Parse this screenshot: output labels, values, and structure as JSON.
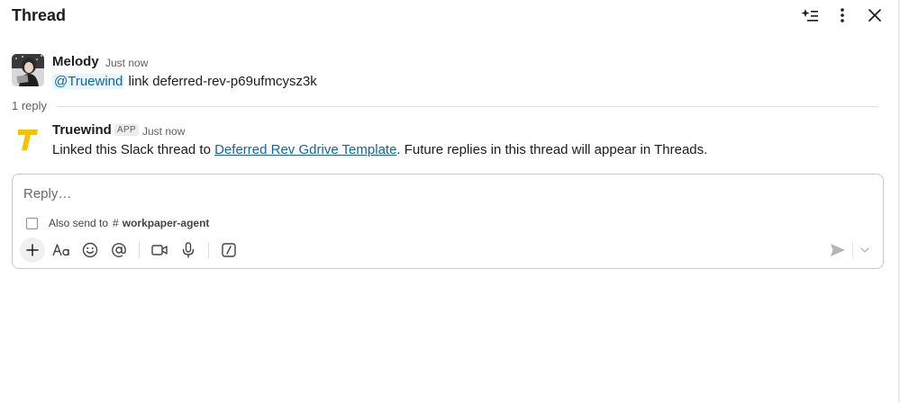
{
  "header": {
    "title": "Thread"
  },
  "messages": [
    {
      "author": "Melody",
      "time": "Just now",
      "mention": "@Truewind",
      "text": " link deferred-rev-p69ufmcysz3k"
    },
    {
      "author": "Truewind",
      "badge": "APP",
      "time": "Just now",
      "text_before": "Linked this Slack thread to ",
      "link_text": "Deferred Rev Gdrive Template",
      "text_after": ". Future replies in this thread will appear in Threads."
    }
  ],
  "reply_count": "1 reply",
  "composer": {
    "placeholder": "Reply…",
    "also_send_label": "Also send to",
    "channel_hash": "#",
    "channel_name": "workpaper-agent"
  },
  "colors": {
    "link": "#1264a3",
    "truewind_logo": "#f5c400",
    "text": "#1d1c1d",
    "muted": "#616061"
  },
  "icons": {
    "header": [
      "sparkle-list-icon",
      "more-vertical-icon",
      "close-icon"
    ],
    "toolbar": [
      "plus-icon",
      "formatting-icon",
      "emoji-icon",
      "mention-icon",
      "video-icon",
      "microphone-icon",
      "slash-command-icon",
      "send-icon",
      "chevron-down-icon"
    ]
  }
}
